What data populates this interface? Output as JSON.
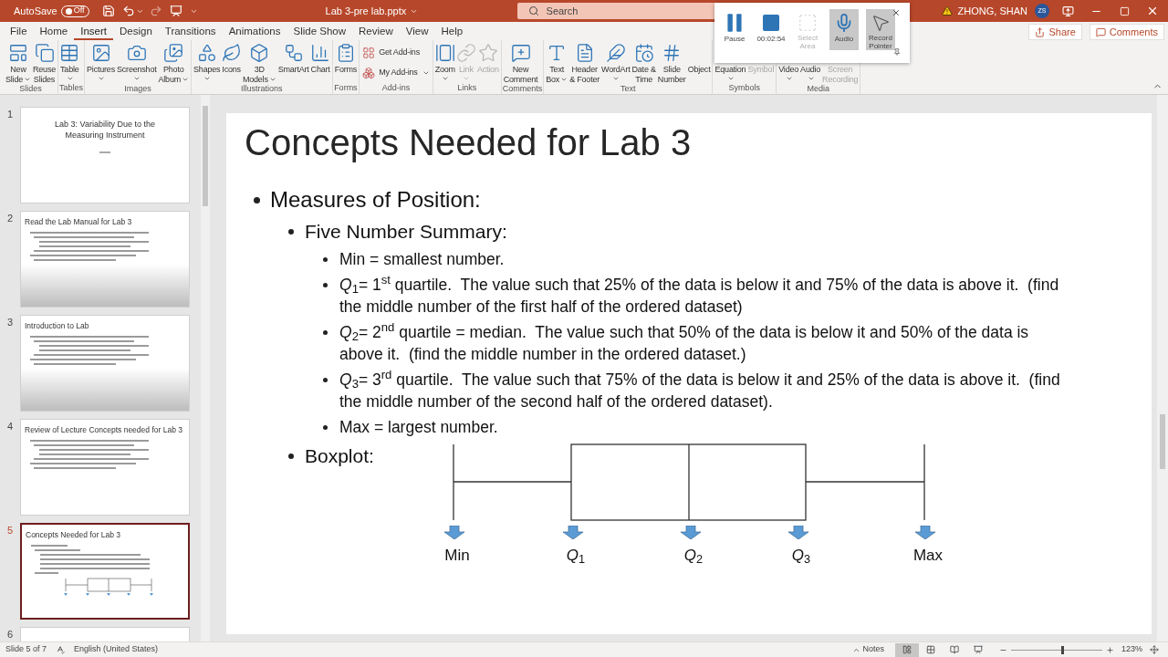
{
  "title_bar": {
    "autosave_label": "AutoSave",
    "autosave": {
      "on": false,
      "label": "Off"
    },
    "file_name": "Lab 3-pre lab.pptx",
    "search": {
      "placeholder": "Search"
    },
    "user_name": "ZHONG, SHAN",
    "avatar": "ZS"
  },
  "tabs": [
    {
      "label": "File",
      "selected": false
    },
    {
      "label": "Home",
      "selected": false
    },
    {
      "label": "Insert",
      "selected": true
    },
    {
      "label": "Design",
      "selected": false
    },
    {
      "label": "Transitions",
      "selected": false
    },
    {
      "label": "Animations",
      "selected": false
    },
    {
      "label": "Slide Show",
      "selected": false
    },
    {
      "label": "Review",
      "selected": false
    },
    {
      "label": "View",
      "selected": false
    },
    {
      "label": "Help",
      "selected": false
    }
  ],
  "share": "Share",
  "comments": "Comments",
  "ribbon": {
    "groups": [
      {
        "label": "Slides",
        "buttons": [
          {
            "label": "New\nSlide",
            "kind": "large",
            "dropdown": true,
            "disabled": false
          },
          {
            "label": "Reuse\nSlides",
            "kind": "large",
            "dropdown": false,
            "disabled": false
          }
        ]
      },
      {
        "label": "Tables",
        "buttons": [
          {
            "label": "Table",
            "kind": "large",
            "dropdown": true,
            "disabled": false
          }
        ]
      },
      {
        "label": "Images",
        "buttons": [
          {
            "label": "Pictures",
            "kind": "large",
            "dropdown": true,
            "disabled": false
          },
          {
            "label": "Screenshot",
            "kind": "large",
            "dropdown": true,
            "disabled": false
          },
          {
            "label": "Photo\nAlbum",
            "kind": "large",
            "dropdown": true,
            "disabled": false
          }
        ]
      },
      {
        "label": "Illustrations",
        "buttons": [
          {
            "label": "Shapes",
            "kind": "large",
            "dropdown": true,
            "disabled": false
          },
          {
            "label": "Icons",
            "kind": "large",
            "dropdown": false,
            "disabled": false
          },
          {
            "label": "3D\nModels",
            "kind": "large",
            "dropdown": true,
            "disabled": false
          },
          {
            "label": "SmartArt",
            "kind": "large",
            "dropdown": false,
            "disabled": false
          },
          {
            "label": "Chart",
            "kind": "large",
            "dropdown": false,
            "disabled": false
          }
        ]
      },
      {
        "label": "Forms",
        "buttons": [
          {
            "label": "Forms",
            "kind": "large",
            "dropdown": false,
            "disabled": false
          }
        ]
      },
      {
        "label": "Add-ins",
        "buttons": [
          {
            "label": "Get Add-ins",
            "kind": "small",
            "dropdown": false,
            "disabled": false
          },
          {
            "label": "My Add-ins",
            "kind": "small",
            "dropdown": true,
            "disabled": false
          }
        ]
      },
      {
        "label": "Links",
        "buttons": [
          {
            "label": "Zoom",
            "kind": "large",
            "dropdown": true,
            "disabled": false
          },
          {
            "label": "Link",
            "kind": "large",
            "dropdown": true,
            "disabled": true
          },
          {
            "label": "Action",
            "kind": "large",
            "dropdown": false,
            "disabled": true
          }
        ]
      },
      {
        "label": "Comments",
        "buttons": [
          {
            "label": "New\nComment",
            "kind": "large",
            "dropdown": false,
            "disabled": false
          }
        ]
      },
      {
        "label": "Text",
        "buttons": [
          {
            "label": "Text\nBox",
            "kind": "large",
            "dropdown": true,
            "disabled": false
          },
          {
            "label": "Header\n& Footer",
            "kind": "large",
            "dropdown": false,
            "disabled": false
          },
          {
            "label": "WordArt",
            "kind": "large",
            "dropdown": true,
            "disabled": false
          },
          {
            "label": "Date &\nTime",
            "kind": "large",
            "dropdown": false,
            "disabled": false
          },
          {
            "label": "Slide\nNumber",
            "kind": "large",
            "dropdown": false,
            "disabled": false
          },
          {
            "label": "Object",
            "kind": "large",
            "dropdown": false,
            "disabled": false
          }
        ]
      },
      {
        "label": "Symbols",
        "buttons": [
          {
            "label": "Equation",
            "kind": "large",
            "dropdown": true,
            "disabled": false
          },
          {
            "label": "Symbol",
            "kind": "large",
            "dropdown": false,
            "disabled": true
          }
        ]
      },
      {
        "label": "Media",
        "buttons": [
          {
            "label": "Video",
            "kind": "large",
            "dropdown": true,
            "disabled": false
          },
          {
            "label": "Audio",
            "kind": "large",
            "dropdown": true,
            "disabled": false
          },
          {
            "label": "Screen\nRecording",
            "kind": "large",
            "dropdown": false,
            "disabled": true
          }
        ]
      }
    ]
  },
  "recording_toolbar": {
    "buttons": [
      {
        "label": "Pause",
        "kind": "pause",
        "on": false,
        "disabled": false
      },
      {
        "label": "00:02:54",
        "kind": "stop",
        "on": false,
        "disabled": false
      },
      {
        "label": "Select\nArea",
        "kind": "select",
        "on": false,
        "disabled": true
      },
      {
        "label": "Audio",
        "kind": "audio",
        "on": true,
        "disabled": false
      },
      {
        "label": "Record\nPointer",
        "kind": "pointer",
        "on": true,
        "disabled": false
      }
    ]
  },
  "thumbnails": [
    {
      "number": "1",
      "selected": false,
      "kind": "title",
      "shaded": false,
      "title": "Lab 3: Variability Due to the Measuring Instrument"
    },
    {
      "number": "2",
      "selected": false,
      "kind": "content",
      "shaded": true,
      "title": "Read the Lab Manual for Lab 3"
    },
    {
      "number": "3",
      "selected": false,
      "kind": "content",
      "shaded": true,
      "title": "Introduction to Lab"
    },
    {
      "number": "4",
      "selected": false,
      "kind": "content",
      "shaded": false,
      "title": "Review of Lecture Concepts needed for Lab 3"
    },
    {
      "number": "5",
      "selected": true,
      "kind": "content_boxplot",
      "shaded": false,
      "title": "Concepts Needed for Lab 3"
    },
    {
      "number": "6",
      "selected": false,
      "kind": "blank"
    }
  ],
  "slide": {
    "kind": "content",
    "title": "Concepts Needed for Lab 3",
    "bullets": [
      {
        "text": "Measures of Position:",
        "children": [
          {
            "text": "Five Number Summary:",
            "children": [
              {
                "text": "Min = smallest number."
              },
              {
                "text": "*Q*$_{1}$= 1$^{st}$ quartile.  The value such that 25% of the data is below it and 75% of the data is above it.  (find the middle number of the first half of the ordered dataset)"
              },
              {
                "text": "*Q*$_{2}$= 2$^{nd}$ quartile = median.  The value such that 50% of the data is below it and 50% of the data is above it.  (find the middle number in the ordered dataset.)"
              },
              {
                "text": "*Q*$_{3}$= 3$^{rd}$ quartile.  The value such that 75% of the data is below it and 25% of the data is above it.  (find the middle number of the second half of the ordered dataset)."
              },
              {
                "text": "Max = largest number."
              }
            ]
          },
          {
            "text": "Boxplot:",
            "boxplot": {
              "labels": [
                "Min",
                "*Q*$_{1}$",
                "*Q*$_{2}$",
                "*Q*$_{3}$",
                "Max"
              ]
            }
          }
        ]
      }
    ]
  },
  "status_bar": {
    "slide_info": "Slide 5 of 7",
    "language": "English (United States)",
    "notes": "Notes",
    "views": [
      {
        "selected": true
      },
      {
        "selected": false
      },
      {
        "selected": false
      },
      {
        "selected": false
      }
    ],
    "zoom": {
      "level": 0.55,
      "label": "123%"
    }
  }
}
